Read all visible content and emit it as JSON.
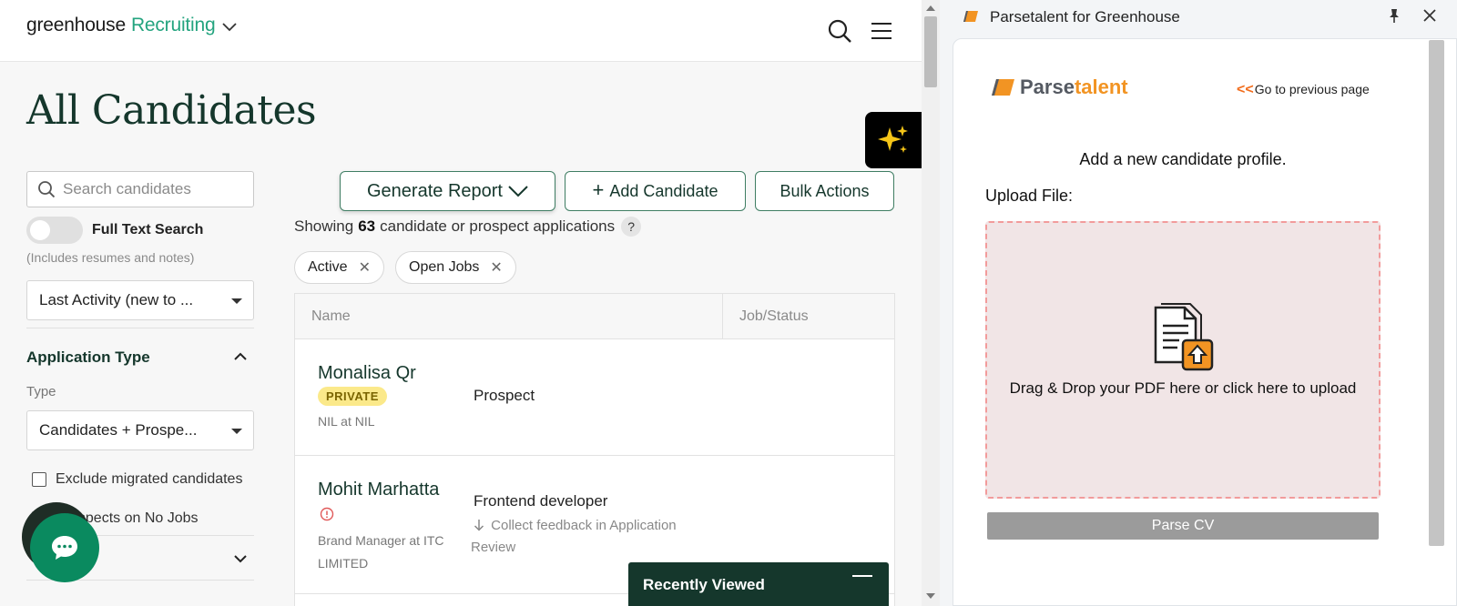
{
  "app": {
    "brand_main": "greenhouse",
    "brand_product": "Recruiting",
    "page_title": "All Candidates"
  },
  "sidebar": {
    "search_placeholder": "Search candidates",
    "full_text_label": "Full Text Search",
    "full_text_hint": "(Includes resumes and notes)",
    "sort_value": "Last Activity (new to ...",
    "section_title": "Application Type",
    "type_label": "Type",
    "type_value": "Candidates + Prospe...",
    "exclude_migrated_label": "Exclude migrated candidates",
    "prospects_no_jobs_label": "Prospects on No Jobs"
  },
  "toolbar": {
    "generate_report_label": "Generate Report",
    "add_candidate_label": "Add Candidate",
    "bulk_actions_label": "Bulk Actions"
  },
  "results": {
    "showing_prefix": "Showing",
    "count": "63",
    "showing_suffix": "candidate or prospect applications",
    "help": "?",
    "filters": [
      "Active",
      "Open Jobs"
    ]
  },
  "table": {
    "columns": [
      "Name",
      "Job/Status"
    ],
    "rows": [
      {
        "name": "Monalisa Qr",
        "badge": "PRIVATE",
        "subtitle": "NIL at NIL",
        "job": "Prospect"
      },
      {
        "name": "Mohit Marhatta",
        "subtitle": "Brand Manager at ITC LIMITED",
        "job": "Frontend developer",
        "stage": "Collect feedback in Application Review"
      }
    ]
  },
  "recently_viewed": {
    "label": "Recently Viewed"
  },
  "extension": {
    "window_title": "Parsetalent for Greenhouse",
    "logo_part1": "Parse",
    "logo_part2": "talent",
    "go_back_arrows": "<<",
    "go_back_label": "Go to previous page",
    "heading": "Add a new candidate profile.",
    "upload_label": "Upload File:",
    "dropzone_text": "Drag & Drop your PDF here or click here to upload",
    "parse_button": "Parse CV"
  },
  "colors": {
    "brand_green": "#24a47f",
    "dark_green": "#15372c",
    "parsetalent_orange": "#f29423",
    "private_badge": "#fbe98a",
    "dropzone_bg": "#f1e5e6"
  },
  "icons": [
    "chevron-down-icon",
    "search-icon",
    "hamburger-menu-icon",
    "sparkle-icon",
    "chevron-up-icon",
    "chat-icon",
    "close-icon",
    "alert-icon",
    "arrow-down-icon",
    "pin-icon",
    "upload-document-icon"
  ]
}
